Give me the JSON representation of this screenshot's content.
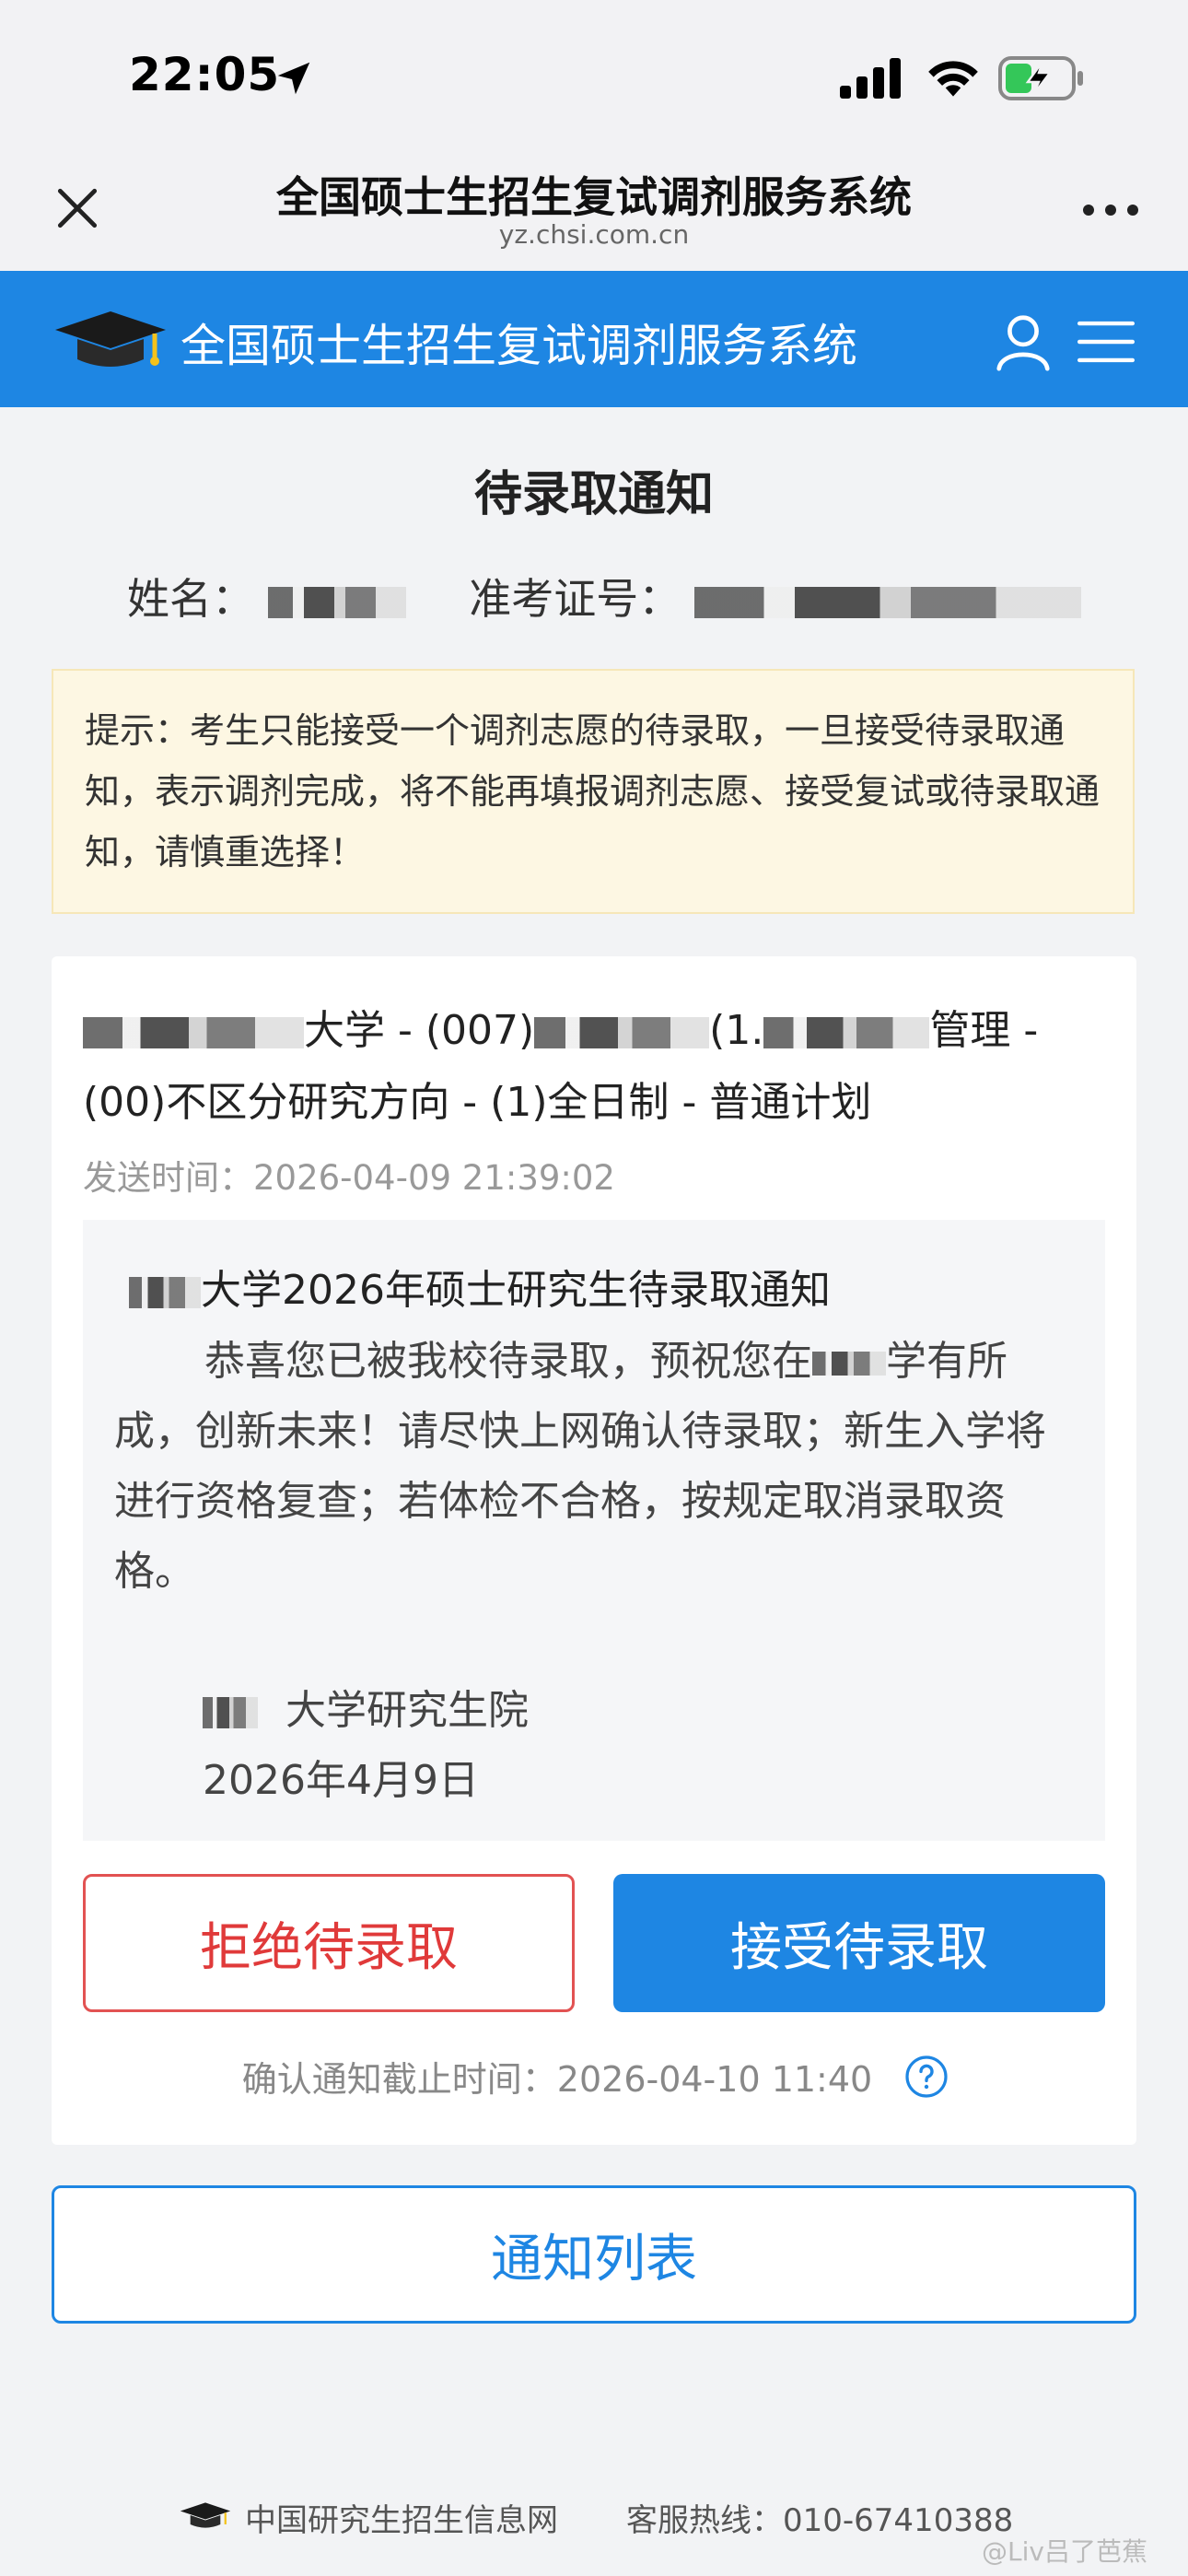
{
  "status_bar": {
    "time": "22:05"
  },
  "browser": {
    "title": "全国硕士生招生复试调剂服务系统",
    "url": "yz.chsi.com.cn"
  },
  "site_header": {
    "title": "全国硕士生招生复试调剂服务系统"
  },
  "page": {
    "title": "待录取通知",
    "name_label": "姓名：",
    "exam_id_label": "准考证号："
  },
  "notice": {
    "text": "提示：考生只能接受一个调剂志愿的待录取，一旦接受待录取通知，表示调剂完成，将不能再填报调剂志愿、接受复试或待录取通知，请慎重选择！"
  },
  "card": {
    "program_line1_a": "大学 - (007)",
    "program_line1_b": "(1.",
    "program_line1_c": "管理 -",
    "program_line2": "(00)不区分研究方向 - (1)全日制 - 普通计划",
    "sent_time": "发送时间：2026-04-09 21:39:02",
    "letter_title": "大学2026年硕士研究生待录取通知",
    "letter_body_a": "恭喜您已被我校待录取，预祝您在",
    "letter_body_b": "学有所成，创新未来！请尽快上网确认待录取；新生入学将进行资格复查；若体检不合格，按规定取消录取资格。",
    "letter_sign_org": "大学研究生院",
    "letter_sign_date": "2026年4月9日",
    "reject_label": "拒绝待录取",
    "accept_label": "接受待录取",
    "deadline": "确认通知截止时间：2026-04-10 11:40"
  },
  "notice_list_label": "通知列表",
  "footer": {
    "site_name": "中国研究生招生信息网",
    "hotline": "客服热线：010-67410388"
  },
  "watermark": "@Liv吕了芭蕉",
  "colors": {
    "accent": "#1e86e3",
    "reject": "#e03a3a",
    "notice_bg": "#fdf7e3"
  }
}
